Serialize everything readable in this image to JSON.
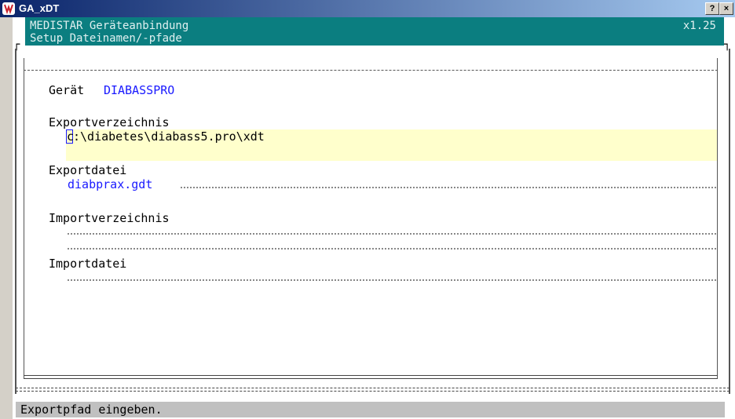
{
  "window": {
    "title": "GA_xDT",
    "help_label": "?",
    "close_label": "×"
  },
  "header": {
    "app_name": "MEDISTAR Geräteanbindung",
    "version": "x1.25",
    "subtitle": "Setup Dateinamen/-pfade"
  },
  "device": {
    "label": "Gerät",
    "value": "DIABASSPRO"
  },
  "fields": {
    "export_dir": {
      "label": "Exportverzeichnis",
      "value_first": "c",
      "value_rest": ":\\diabetes\\diabass5.pro\\xdt"
    },
    "export_file": {
      "label": "Exportdatei",
      "value": "diabprax.gdt"
    },
    "import_dir": {
      "label": "Importverzeichnis",
      "value": ""
    },
    "import_file": {
      "label": "Importdatei",
      "value": ""
    }
  },
  "status": {
    "message": "Exportpfad eingeben."
  },
  "colors": {
    "header_bg": "#0b7e80",
    "value_text": "#1a1aff",
    "highlight": "#ffffcc",
    "titlebar": "#0a246a"
  }
}
